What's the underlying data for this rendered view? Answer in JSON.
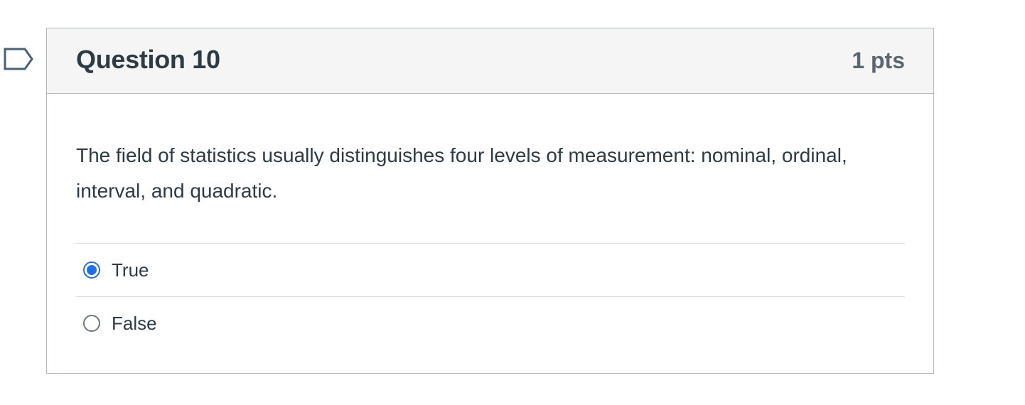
{
  "question": {
    "title": "Question 10",
    "points": "1 pts",
    "text": "The field of statistics usually distinguishes four levels of measurement: nominal, ordinal, interval, and quadratic.",
    "answers": [
      {
        "label": "True",
        "selected": true
      },
      {
        "label": "False",
        "selected": false
      }
    ]
  },
  "icons": {
    "flag": "bookmark-flag-icon",
    "radio_selected": "radio-selected-icon",
    "radio_unselected": "radio-unselected-icon"
  },
  "colors": {
    "accent": "#1f6fe5",
    "header_bg": "#f5f5f5",
    "text": "#2d3b45",
    "border": "#b3b8bd"
  }
}
